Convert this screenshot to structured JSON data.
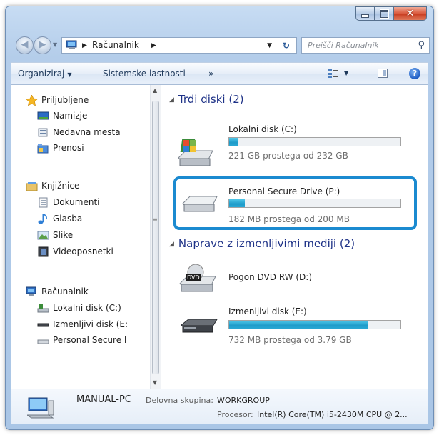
{
  "window": {
    "address": {
      "crumb": "Računalnik"
    },
    "search": {
      "placeholder": "Preišči Računalnik"
    }
  },
  "toolbar": {
    "organize": "Organiziraj",
    "system_properties": "Sistemske lastnosti",
    "more": "»"
  },
  "navpane": {
    "favorites": "Priljubljene",
    "desktop": "Namizje",
    "recent": "Nedavna mesta",
    "downloads": "Prenosi",
    "libraries": "Knjižnice",
    "documents": "Dokumenti",
    "music": "Glasba",
    "pictures": "Slike",
    "videos": "Videoposnetki",
    "computer": "Računalnik",
    "local_disk": "Lokalni disk (C:)",
    "removable": "Izmenljivi disk (E:",
    "personal": "Personal Secure I"
  },
  "groups": {
    "hard_disks": "Trdi diski (2)",
    "removable": "Naprave z izmenljivimi mediji (2)"
  },
  "drives": [
    {
      "name": "Lokalni disk (C:)",
      "free": "221 GB prostega od 232 GB",
      "used_fraction": 0.05
    },
    {
      "name": "Personal Secure Drive (P:)",
      "free": "182 MB prostega od 200 MB",
      "used_fraction": 0.09
    },
    {
      "name": "Pogon DVD RW (D:)"
    },
    {
      "name": "Izmenljivi disk (E:)",
      "free": "732 MB prostega od 3.79 GB",
      "used_fraction": 0.81
    }
  ],
  "details": {
    "pc_name": "MANUAL-PC",
    "workgroup_label": "Delovna skupina:",
    "workgroup": "WORKGROUP",
    "cpu_label": "Procesor:",
    "cpu": "Intel(R) Core(TM) i5-2430M CPU @ 2..."
  }
}
